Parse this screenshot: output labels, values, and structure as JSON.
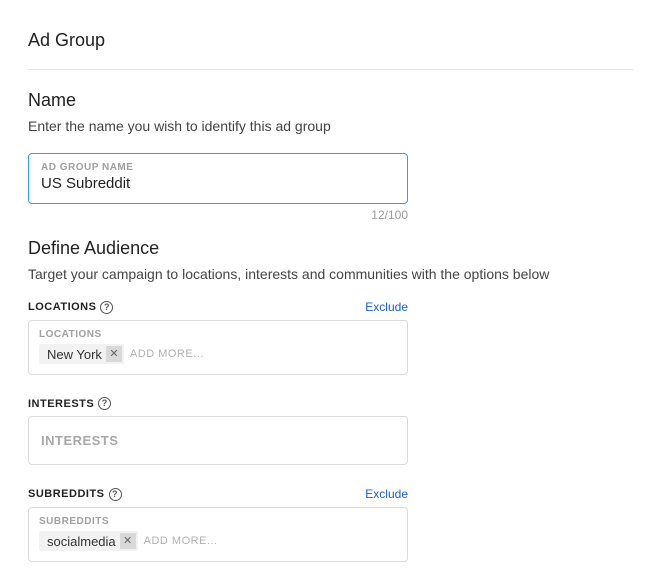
{
  "page": {
    "title": "Ad Group"
  },
  "name_section": {
    "heading": "Name",
    "description": "Enter the name you wish to identify this ad group",
    "floating_label": "Ad Group Name",
    "value": "US Subreddit",
    "char_count": "12/100"
  },
  "audience_section": {
    "heading": "Define Audience",
    "description": "Target your campaign to locations, interests and communities with the options below"
  },
  "locations": {
    "label": "Locations",
    "exclude": "Exclude",
    "inner_label": "Locations",
    "tag": "New York",
    "add_more": "Add more..."
  },
  "interests": {
    "label": "Interests",
    "placeholder": "Interests"
  },
  "subreddits": {
    "label": "Subreddits",
    "exclude": "Exclude",
    "inner_label": "Subreddits",
    "tag": "socialmedia",
    "add_more": "Add more..."
  }
}
